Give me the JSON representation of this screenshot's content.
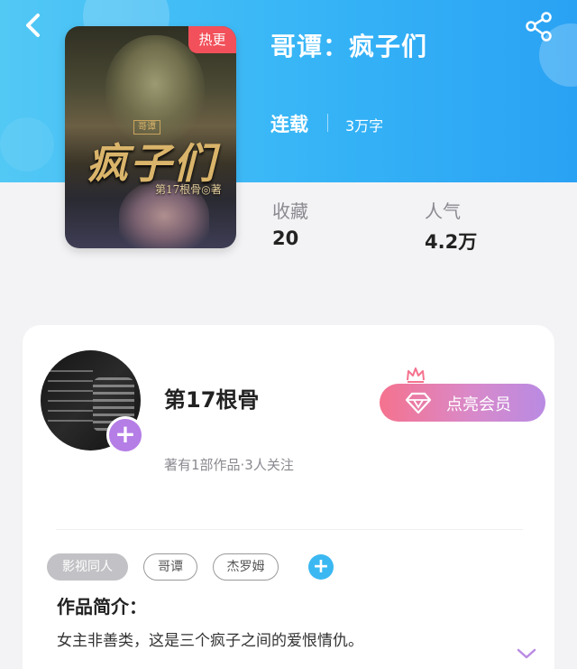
{
  "header": {
    "back_icon": "chevron-left-icon",
    "share_icon": "share-icon",
    "accent_color": "#36b4f6"
  },
  "book": {
    "title": "哥谭：疯子们",
    "hot_badge": "热更",
    "status": "连载",
    "word_count": "3万字",
    "cover": {
      "tag": "哥谭",
      "title": "疯子们",
      "author_line": "第17根骨◎著"
    }
  },
  "stats": {
    "favorites_label": "收藏",
    "favorites_value": "20",
    "popularity_label": "人气",
    "popularity_value": "4.2万"
  },
  "author": {
    "name": "第17根骨",
    "meta": "著有1部作品·3人关注",
    "follow_icon": "plus-icon",
    "vip_button": "点亮会员",
    "vip_icon": "diamond-icon",
    "crown_icon": "crown-icon"
  },
  "tags": {
    "items": [
      "影视同人",
      "哥谭",
      "杰罗姆"
    ],
    "add_label": "+"
  },
  "intro": {
    "title": "作品简介：",
    "text": "女主非善类，这是三个疯子之间的爱恨情仇。",
    "expand_icon": "chevron-down-icon"
  }
}
